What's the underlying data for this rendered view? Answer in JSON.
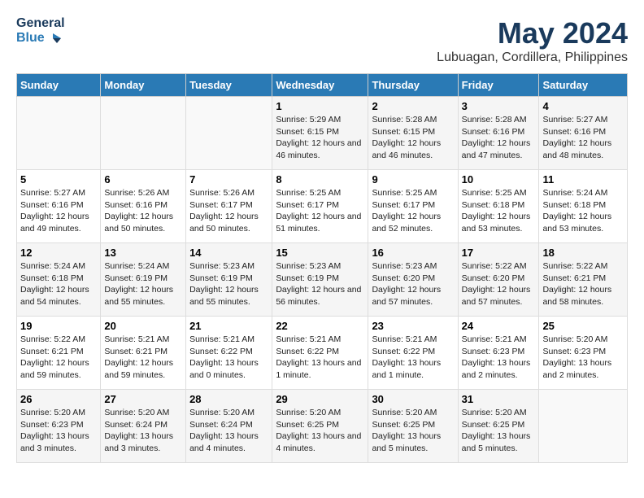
{
  "header": {
    "logo_line1": "General",
    "logo_line2": "Blue",
    "title": "May 2024",
    "subtitle": "Lubuagan, Cordillera, Philippines"
  },
  "weekdays": [
    "Sunday",
    "Monday",
    "Tuesday",
    "Wednesday",
    "Thursday",
    "Friday",
    "Saturday"
  ],
  "weeks": [
    [
      {
        "day": "",
        "sunrise": "",
        "sunset": "",
        "daylight": ""
      },
      {
        "day": "",
        "sunrise": "",
        "sunset": "",
        "daylight": ""
      },
      {
        "day": "",
        "sunrise": "",
        "sunset": "",
        "daylight": ""
      },
      {
        "day": "1",
        "sunrise": "Sunrise: 5:29 AM",
        "sunset": "Sunset: 6:15 PM",
        "daylight": "Daylight: 12 hours and 46 minutes."
      },
      {
        "day": "2",
        "sunrise": "Sunrise: 5:28 AM",
        "sunset": "Sunset: 6:15 PM",
        "daylight": "Daylight: 12 hours and 46 minutes."
      },
      {
        "day": "3",
        "sunrise": "Sunrise: 5:28 AM",
        "sunset": "Sunset: 6:16 PM",
        "daylight": "Daylight: 12 hours and 47 minutes."
      },
      {
        "day": "4",
        "sunrise": "Sunrise: 5:27 AM",
        "sunset": "Sunset: 6:16 PM",
        "daylight": "Daylight: 12 hours and 48 minutes."
      }
    ],
    [
      {
        "day": "5",
        "sunrise": "Sunrise: 5:27 AM",
        "sunset": "Sunset: 6:16 PM",
        "daylight": "Daylight: 12 hours and 49 minutes."
      },
      {
        "day": "6",
        "sunrise": "Sunrise: 5:26 AM",
        "sunset": "Sunset: 6:16 PM",
        "daylight": "Daylight: 12 hours and 50 minutes."
      },
      {
        "day": "7",
        "sunrise": "Sunrise: 5:26 AM",
        "sunset": "Sunset: 6:17 PM",
        "daylight": "Daylight: 12 hours and 50 minutes."
      },
      {
        "day": "8",
        "sunrise": "Sunrise: 5:25 AM",
        "sunset": "Sunset: 6:17 PM",
        "daylight": "Daylight: 12 hours and 51 minutes."
      },
      {
        "day": "9",
        "sunrise": "Sunrise: 5:25 AM",
        "sunset": "Sunset: 6:17 PM",
        "daylight": "Daylight: 12 hours and 52 minutes."
      },
      {
        "day": "10",
        "sunrise": "Sunrise: 5:25 AM",
        "sunset": "Sunset: 6:18 PM",
        "daylight": "Daylight: 12 hours and 53 minutes."
      },
      {
        "day": "11",
        "sunrise": "Sunrise: 5:24 AM",
        "sunset": "Sunset: 6:18 PM",
        "daylight": "Daylight: 12 hours and 53 minutes."
      }
    ],
    [
      {
        "day": "12",
        "sunrise": "Sunrise: 5:24 AM",
        "sunset": "Sunset: 6:18 PM",
        "daylight": "Daylight: 12 hours and 54 minutes."
      },
      {
        "day": "13",
        "sunrise": "Sunrise: 5:24 AM",
        "sunset": "Sunset: 6:19 PM",
        "daylight": "Daylight: 12 hours and 55 minutes."
      },
      {
        "day": "14",
        "sunrise": "Sunrise: 5:23 AM",
        "sunset": "Sunset: 6:19 PM",
        "daylight": "Daylight: 12 hours and 55 minutes."
      },
      {
        "day": "15",
        "sunrise": "Sunrise: 5:23 AM",
        "sunset": "Sunset: 6:19 PM",
        "daylight": "Daylight: 12 hours and 56 minutes."
      },
      {
        "day": "16",
        "sunrise": "Sunrise: 5:23 AM",
        "sunset": "Sunset: 6:20 PM",
        "daylight": "Daylight: 12 hours and 57 minutes."
      },
      {
        "day": "17",
        "sunrise": "Sunrise: 5:22 AM",
        "sunset": "Sunset: 6:20 PM",
        "daylight": "Daylight: 12 hours and 57 minutes."
      },
      {
        "day": "18",
        "sunrise": "Sunrise: 5:22 AM",
        "sunset": "Sunset: 6:21 PM",
        "daylight": "Daylight: 12 hours and 58 minutes."
      }
    ],
    [
      {
        "day": "19",
        "sunrise": "Sunrise: 5:22 AM",
        "sunset": "Sunset: 6:21 PM",
        "daylight": "Daylight: 12 hours and 59 minutes."
      },
      {
        "day": "20",
        "sunrise": "Sunrise: 5:21 AM",
        "sunset": "Sunset: 6:21 PM",
        "daylight": "Daylight: 12 hours and 59 minutes."
      },
      {
        "day": "21",
        "sunrise": "Sunrise: 5:21 AM",
        "sunset": "Sunset: 6:22 PM",
        "daylight": "Daylight: 13 hours and 0 minutes."
      },
      {
        "day": "22",
        "sunrise": "Sunrise: 5:21 AM",
        "sunset": "Sunset: 6:22 PM",
        "daylight": "Daylight: 13 hours and 1 minute."
      },
      {
        "day": "23",
        "sunrise": "Sunrise: 5:21 AM",
        "sunset": "Sunset: 6:22 PM",
        "daylight": "Daylight: 13 hours and 1 minute."
      },
      {
        "day": "24",
        "sunrise": "Sunrise: 5:21 AM",
        "sunset": "Sunset: 6:23 PM",
        "daylight": "Daylight: 13 hours and 2 minutes."
      },
      {
        "day": "25",
        "sunrise": "Sunrise: 5:20 AM",
        "sunset": "Sunset: 6:23 PM",
        "daylight": "Daylight: 13 hours and 2 minutes."
      }
    ],
    [
      {
        "day": "26",
        "sunrise": "Sunrise: 5:20 AM",
        "sunset": "Sunset: 6:23 PM",
        "daylight": "Daylight: 13 hours and 3 minutes."
      },
      {
        "day": "27",
        "sunrise": "Sunrise: 5:20 AM",
        "sunset": "Sunset: 6:24 PM",
        "daylight": "Daylight: 13 hours and 3 minutes."
      },
      {
        "day": "28",
        "sunrise": "Sunrise: 5:20 AM",
        "sunset": "Sunset: 6:24 PM",
        "daylight": "Daylight: 13 hours and 4 minutes."
      },
      {
        "day": "29",
        "sunrise": "Sunrise: 5:20 AM",
        "sunset": "Sunset: 6:25 PM",
        "daylight": "Daylight: 13 hours and 4 minutes."
      },
      {
        "day": "30",
        "sunrise": "Sunrise: 5:20 AM",
        "sunset": "Sunset: 6:25 PM",
        "daylight": "Daylight: 13 hours and 5 minutes."
      },
      {
        "day": "31",
        "sunrise": "Sunrise: 5:20 AM",
        "sunset": "Sunset: 6:25 PM",
        "daylight": "Daylight: 13 hours and 5 minutes."
      },
      {
        "day": "",
        "sunrise": "",
        "sunset": "",
        "daylight": ""
      }
    ]
  ]
}
